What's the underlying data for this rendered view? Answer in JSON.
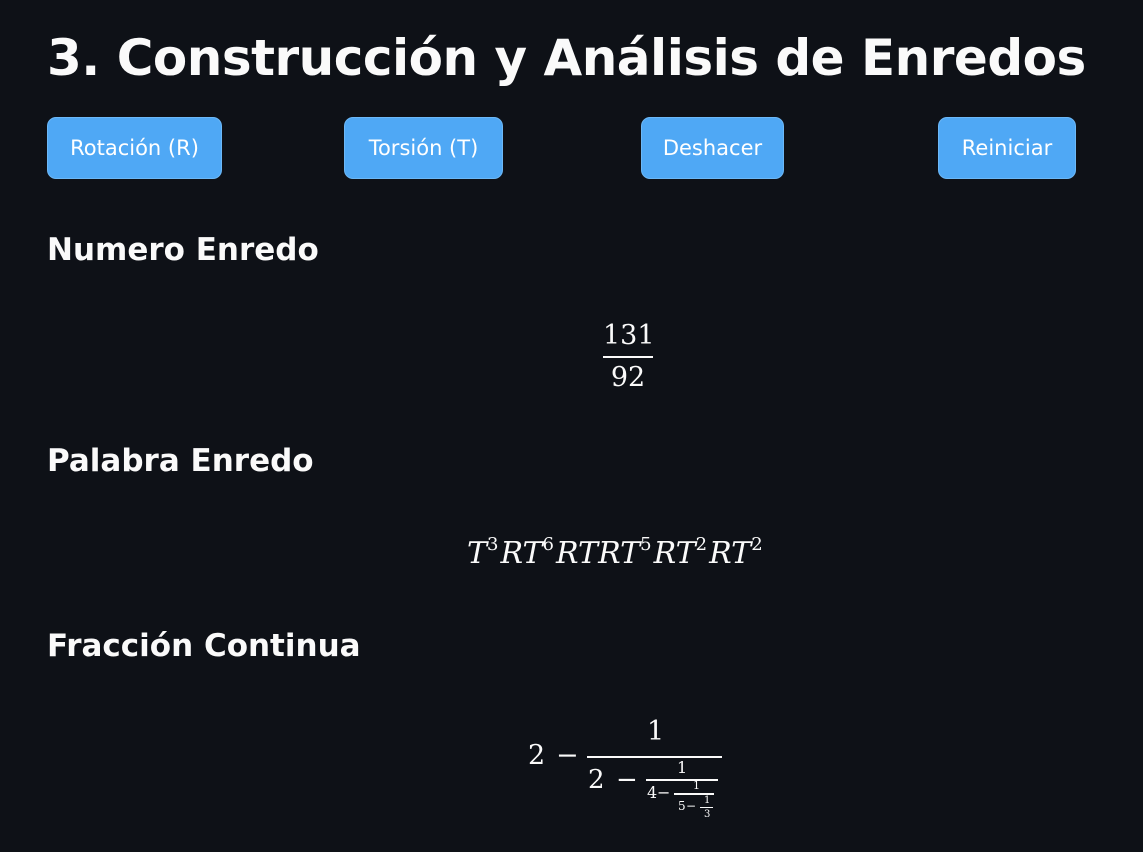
{
  "page": {
    "title": "3. Construcción y Análisis de Enredos"
  },
  "toolbar": {
    "rotation_label": "Rotación (R)",
    "torsion_label": "Torsión (T)",
    "undo_label": "Deshacer",
    "reset_label": "Reiniciar"
  },
  "colors": {
    "background": "#0e1117",
    "button": "#4fa8f5",
    "text": "#fafafa"
  },
  "sections": {
    "numero": {
      "heading": "Numero Enredo",
      "numerator": "131",
      "denominator": "92"
    },
    "palabra": {
      "heading": "Palabra Enredo",
      "terms": [
        {
          "base": "T",
          "exp": "3"
        },
        {
          "base": "RT",
          "exp": "6"
        },
        {
          "base": "RTRT",
          "exp": "5"
        },
        {
          "base": "RT",
          "exp": "2"
        },
        {
          "base": "RT",
          "exp": "2"
        }
      ]
    },
    "fraccion": {
      "heading": "Fracción Continua",
      "level1_whole": "2",
      "level1_minus": "−",
      "level1_num": "1",
      "level2_whole": "2",
      "level2_minus": "−",
      "level2_num": "1",
      "level3_whole": "4",
      "level3_minus": "−",
      "level3_num": "1",
      "level4_whole": "5",
      "level4_minus": "−",
      "level4_num": "1",
      "level4_den": "3"
    }
  }
}
